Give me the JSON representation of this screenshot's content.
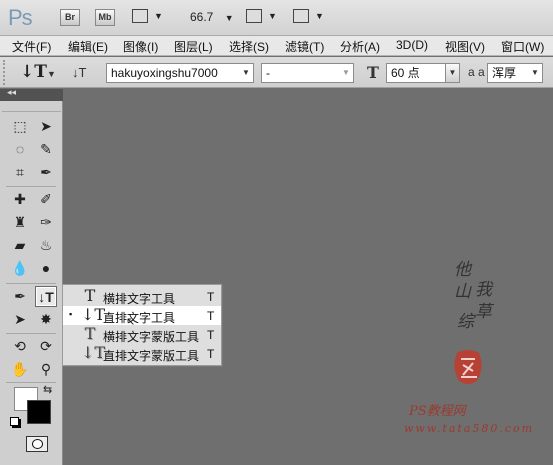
{
  "appbar": {
    "logo": "Ps",
    "bridge_label": "Br",
    "minibridge_label": "Mb",
    "zoom": "66.7"
  },
  "menubar": {
    "items": [
      "文件(F)",
      "编辑(E)",
      "图像(I)",
      "图层(L)",
      "选择(S)",
      "滤镜(T)",
      "分析(A)",
      "3D(D)",
      "视图(V)",
      "窗口(W)"
    ]
  },
  "options": {
    "font_family": "hakuyoxingshu7000",
    "font_style": "-",
    "font_size": "60 点",
    "antialias_label": "a a",
    "antialias": "浑厚"
  },
  "flyout": {
    "items": [
      {
        "label": "横排文字工具",
        "key": "T",
        "icon": "T",
        "selected": false
      },
      {
        "label": "直排文字工具",
        "key": "T",
        "icon": "↓T",
        "selected": true
      },
      {
        "label": "横排文字蒙版工具",
        "key": "T",
        "icon": "T",
        "selected": false
      },
      {
        "label": "直排文字蒙版工具",
        "key": "T",
        "icon": "↓T",
        "selected": false
      }
    ],
    "bullet": "▪"
  },
  "watermark": {
    "col1": "他山",
    "col2": "我草",
    "col3": "综",
    "line": "PS教程网",
    "url": "www.tata580.com"
  },
  "colors": {
    "foreground": "#ffffff",
    "background": "#000000",
    "canvas": "#6f6f6f"
  }
}
